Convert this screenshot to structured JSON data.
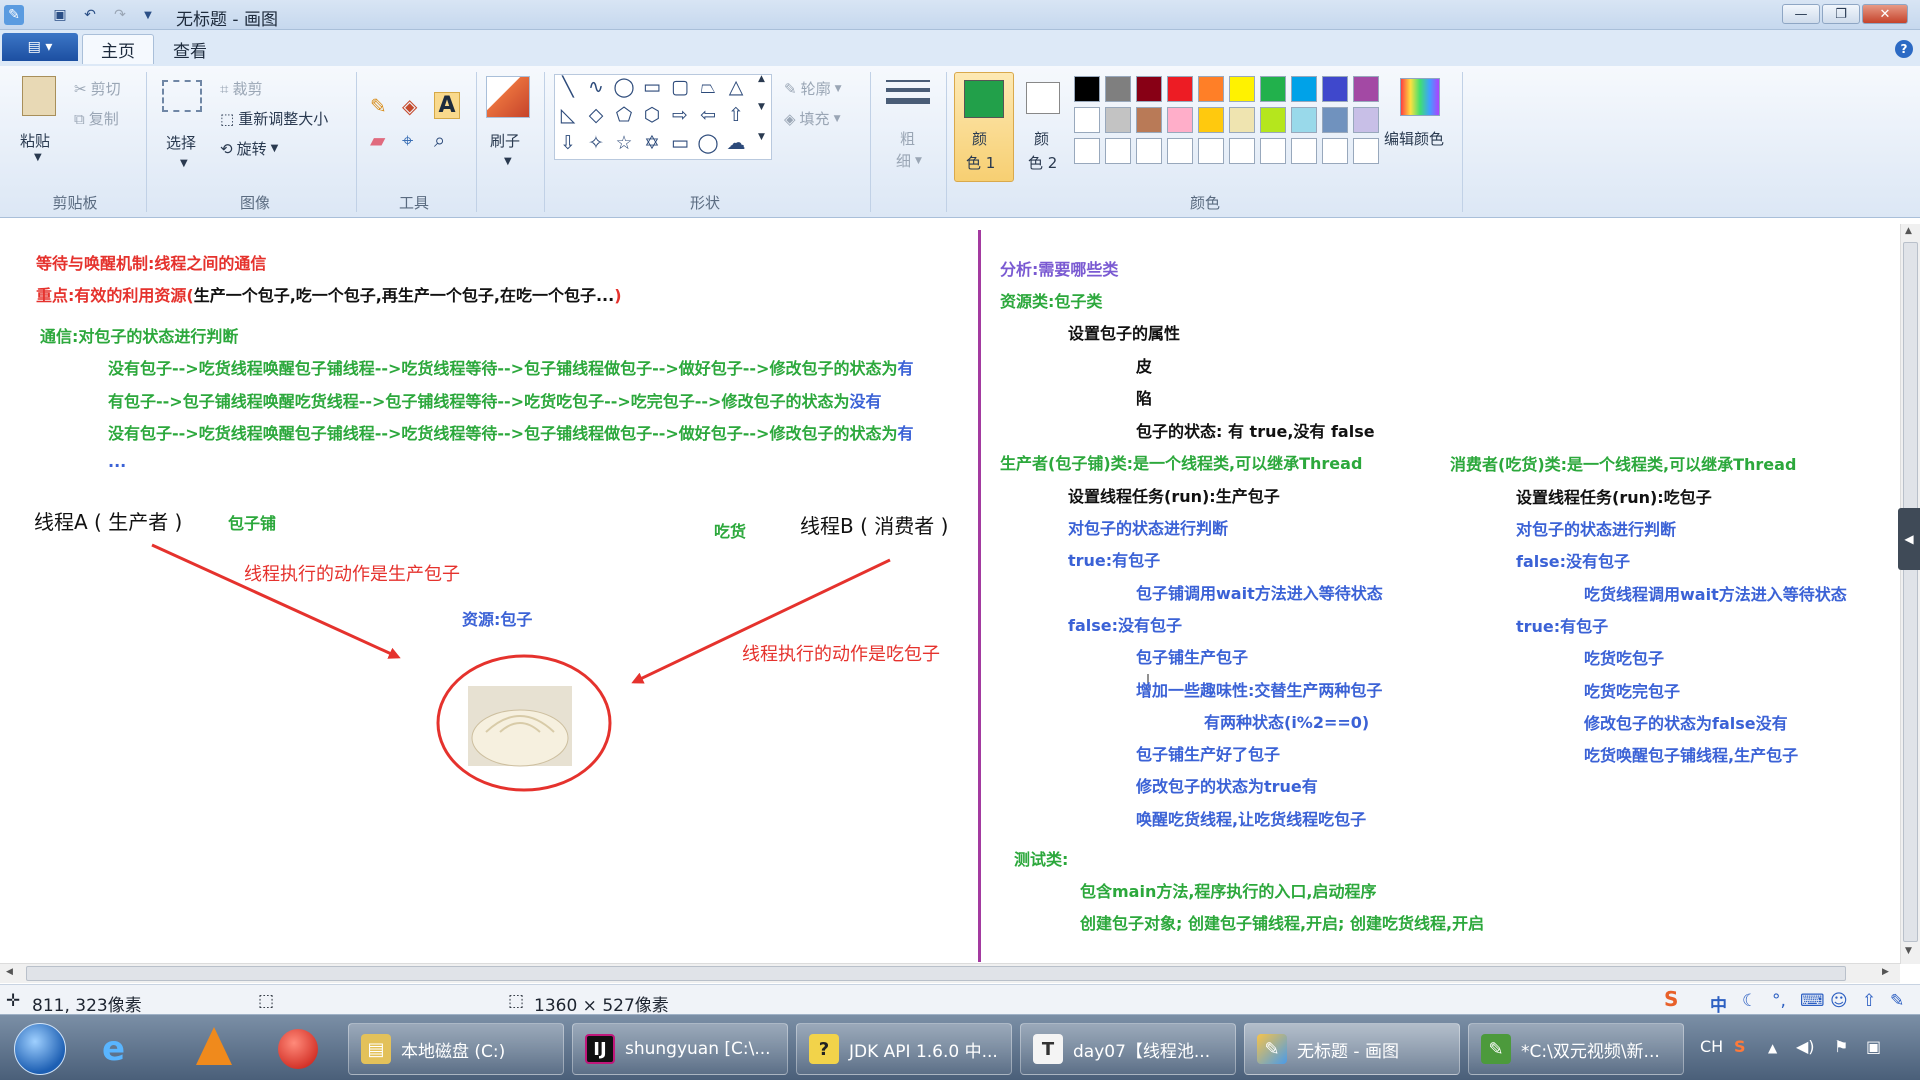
{
  "window": {
    "title": "无标题 - 画图",
    "min_glyph": "—",
    "max_glyph": "❐",
    "close_glyph": "✕"
  },
  "tabs": {
    "file_glyph": "▤ ▾",
    "home": "主页",
    "view": "查看",
    "help": "?"
  },
  "ribbon": {
    "clipboard": {
      "paste": "粘贴",
      "cut": "剪切",
      "copy": "复制",
      "group": "剪贴板"
    },
    "image": {
      "select": "选择",
      "crop": "裁剪",
      "resize": "重新调整大小",
      "rotate": "旋转",
      "group": "图像"
    },
    "tools": {
      "group": "工具",
      "text_glyph": "A"
    },
    "brush": {
      "label": "刷子"
    },
    "shapes": {
      "outline": "轮廓",
      "fill": "填充",
      "group": "形状"
    },
    "size": {
      "label1": "粗",
      "label2": "细"
    },
    "colors": {
      "color1_l1": "颜",
      "color1_l2": "色 1",
      "color2_l1": "颜",
      "color2_l2": "色 2",
      "edit": "编辑颜色",
      "group": "颜色",
      "color1": "#22a04a",
      "palette": [
        "#000000",
        "#7f7f7f",
        "#880015",
        "#ed1c24",
        "#ff7f27",
        "#fff200",
        "#22b14c",
        "#00a2e8",
        "#3f48cc",
        "#a349a4",
        "#ffffff",
        "#c3c3c3",
        "#b97a57",
        "#ffaec9",
        "#ffc90e",
        "#efe4b0",
        "#b5e61d",
        "#99d9ea",
        "#7092be",
        "#c8bfe7"
      ]
    }
  },
  "canvas": {
    "left": {
      "l1": "等待与唤醒机制:线程之间的通信",
      "l2a": "重点:有效的利用资源(",
      "l2b": "生产一个包子,吃一个包子,再生产一个包子,在吃一个包子...",
      "l2c": ")",
      "l3": "通信:对包子的状态进行判断",
      "l4a": "没有包子-->吃货线程唤醒包子铺线程-->吃货线程等待-->包子铺线程做包子-->做好包子-->修改包子的状态为",
      "l4b": "有",
      "l5a": "有包子-->包子铺线程唤醒吃货线程-->包子铺线程等待-->吃货吃包子-->吃完包子-->修改包子的状态为",
      "l5b": "没有",
      "l6a": "没有包子-->吃货线程唤醒包子铺线程-->吃货线程等待-->包子铺线程做包子-->做好包子-->修改包子的状态为",
      "l6b": "有",
      "l7": "...",
      "threadA": "线程A ( 生产者 )",
      "shop": "包子铺",
      "eater": "吃货",
      "threadB": "线程B ( 消费者 )",
      "actionA": "线程执行的动作是生产包子",
      "resource": "资源:包子",
      "actionB": "线程执行的动作是吃包子"
    },
    "right": {
      "a1": "分析:需要哪些类",
      "a2": "资源类:包子类",
      "a3": "设置包子的属性",
      "a4": "皮",
      "a5": "陷",
      "a6": "包子的状态: 有 true,没有 false",
      "p1": "生产者(包子铺)类:是一个线程类,可以继承Thread",
      "p2": "设置线程任务(run):生产包子",
      "p3": "对包子的状态进行判断",
      "p4": "true:有包子",
      "p5": "包子铺调用wait方法进入等待状态",
      "p6": "false:没有包子",
      "p7": "包子铺生产包子",
      "p8": "增加一些趣味性:交替生产两种包子",
      "p9": "有两种状态(i%2==0)",
      "p10": "包子铺生产好了包子",
      "p11": "修改包子的状态为true有",
      "p12": "唤醒吃货线程,让吃货线程吃包子",
      "c1": "消费者(吃货)类:是一个线程类,可以继承Thread",
      "c2": "设置线程任务(run):吃包子",
      "c3": "对包子的状态进行判断",
      "c4": "false:没有包子",
      "c5": "吃货线程调用wait方法进入等待状态",
      "c6": "true:有包子",
      "c7": "吃货吃包子",
      "c8": "吃货吃完包子",
      "c9": "修改包子的状态为false没有",
      "c10": "吃货唤醒包子铺线程,生产包子",
      "t1": "测试类:",
      "t2": "包含main方法,程序执行的入口,启动程序",
      "t3": "创建包子对象; 创建包子铺线程,开启; 创建吃货线程,开启"
    }
  },
  "status": {
    "pos": "811, 323像素",
    "size": "1360 × 527像素"
  },
  "taskbar": {
    "items": [
      "本地磁盘 (C:)",
      "shungyuan [C:\\...",
      "JDK API 1.6.0 中...",
      "day07【线程池...",
      "无标题 - 画图",
      "*C:\\双元视频\\新..."
    ],
    "lang": "CH",
    "ime": "中"
  }
}
